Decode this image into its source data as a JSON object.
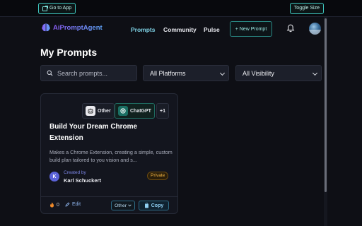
{
  "extension_bar": {
    "go_to_app": "Go to App",
    "toggle_size": "Toggle Size"
  },
  "nav": {
    "logo_text": "AiPromptAgent",
    "links": [
      {
        "label": "Prompts",
        "active": true
      },
      {
        "label": "Community",
        "active": false
      },
      {
        "label": "Pulse",
        "active": false
      }
    ],
    "new_prompt": "+ New Prompt",
    "icons": [
      "bell-icon",
      "avatar"
    ]
  },
  "main": {
    "title": "My Prompts",
    "search": {
      "placeholder": "Search prompts...",
      "value": ""
    },
    "platform_filter": "All Platforms",
    "visibility_filter": "All Visibility"
  },
  "card": {
    "platforms": [
      "Other",
      "ChatGPT"
    ],
    "more_count": "+1",
    "title": "Build Your Dream Chrome Extension",
    "description": "Makes a Chrome Extension, creating a simple, custom build plan tailored to you vision and s...",
    "author_initial": "K",
    "created_by_label": "Created by",
    "author_name": "Karl Schuckert",
    "visibility_badge": "Private",
    "likes": "0",
    "edit_label": "Edit",
    "model_select": "Other",
    "copy_label": "Copy"
  },
  "colors": {
    "background": "#0e0f15",
    "accent_cyan": "#3fc8c0",
    "active_nav": "#7fd3e6",
    "private_badge": "#f1b443"
  }
}
